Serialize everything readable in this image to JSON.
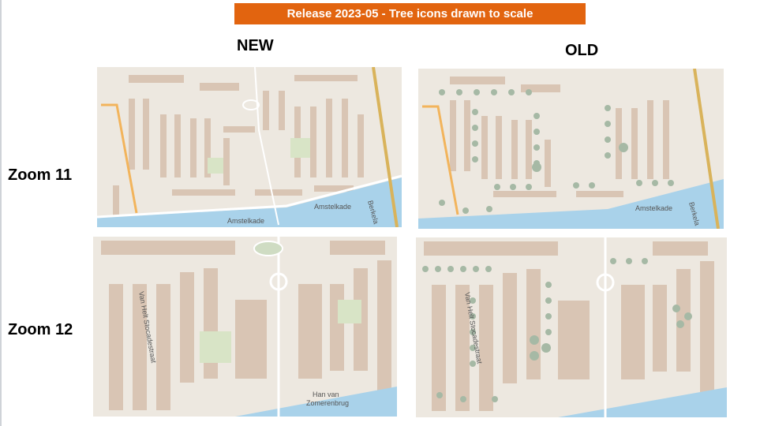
{
  "title": "Release 2023-05 - Tree icons drawn to scale",
  "columns": {
    "new": "NEW",
    "old": "OLD"
  },
  "rows": {
    "zoom11": "Zoom 11",
    "zoom12": "Zoom 12"
  },
  "map_labels": {
    "amstelkade": "Amstelkade",
    "berkel": "Berkela",
    "van_helt": "Van Helt Stocadestraat",
    "han_van": "Han van",
    "zomerenbrug": "Zomerenbrug"
  },
  "colors": {
    "banner": "#e2640f",
    "water": "#a9d2ea",
    "building": "#d9c5b4",
    "road": "#ffffff",
    "tree": "#a6b9a5",
    "park": "#d8e4c6",
    "arterial": "#f2b45c"
  }
}
